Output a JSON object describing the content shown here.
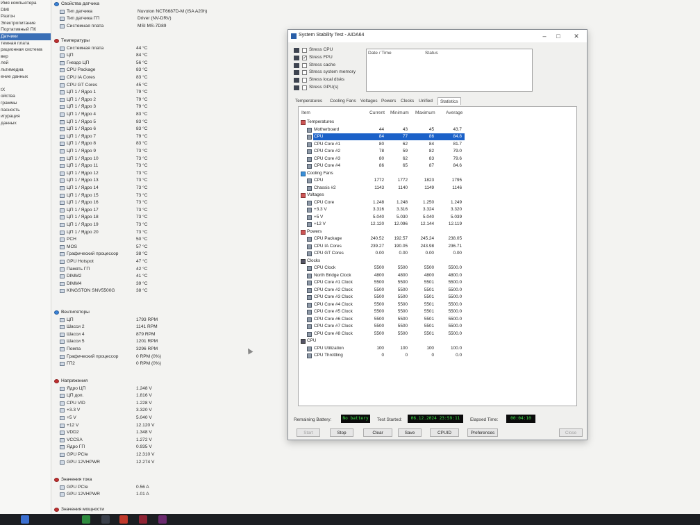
{
  "left_nav": {
    "items": [
      "Имя компьютера",
      "DMI",
      "Разгон",
      "Электропитание",
      "Портативный ПК",
      "Датчики",
      "темная плата",
      "рационная система",
      "вер",
      "лей",
      "льтимедиа",
      "ение данных",
      "",
      "tX",
      "ойства",
      "граммы",
      "пасность",
      "игурация",
      "данных",
      ""
    ],
    "selected_index": 5
  },
  "sensor_props": {
    "title": "Свойства датчика",
    "rows": [
      {
        "name": "Тип датчика",
        "value": "Nuvoton NCT6687D-M  (ISA A20h)"
      },
      {
        "name": "Тип датчика ГП",
        "value": "Driver  (NV-DRV)"
      },
      {
        "name": "Системная плата",
        "value": "MSI MS-7D89"
      }
    ]
  },
  "temperatures": {
    "title": "Температуры",
    "rows": [
      {
        "name": "Системная плата",
        "value": "44 °C"
      },
      {
        "name": "ЦП",
        "value": "84 °C"
      },
      {
        "name": "Гнездо ЦП",
        "value": "56 °C"
      },
      {
        "name": "CPU Package",
        "value": "83 °C"
      },
      {
        "name": "CPU IA Cores",
        "value": "83 °C"
      },
      {
        "name": "CPU GT Cores",
        "value": "45 °C"
      },
      {
        "name": "ЦП 1 / Ядро 1",
        "value": "79 °C"
      },
      {
        "name": "ЦП 1 / Ядро 2",
        "value": "79 °C"
      },
      {
        "name": "ЦП 1 / Ядро 3",
        "value": "79 °C"
      },
      {
        "name": "ЦП 1 / Ядро 4",
        "value": "83 °C"
      },
      {
        "name": "ЦП 1 / Ядро 5",
        "value": "83 °C"
      },
      {
        "name": "ЦП 1 / Ядро 6",
        "value": "83 °C"
      },
      {
        "name": "ЦП 1 / Ядро 7",
        "value": "79 °C"
      },
      {
        "name": "ЦП 1 / Ядро 8",
        "value": "83 °C"
      },
      {
        "name": "ЦП 1 / Ядро 9",
        "value": "73 °C"
      },
      {
        "name": "ЦП 1 / Ядро 10",
        "value": "73 °C"
      },
      {
        "name": "ЦП 1 / Ядро 11",
        "value": "73 °C"
      },
      {
        "name": "ЦП 1 / Ядро 12",
        "value": "73 °C"
      },
      {
        "name": "ЦП 1 / Ядро 13",
        "value": "73 °C"
      },
      {
        "name": "ЦП 1 / Ядро 14",
        "value": "73 °C"
      },
      {
        "name": "ЦП 1 / Ядро 15",
        "value": "73 °C"
      },
      {
        "name": "ЦП 1 / Ядро 16",
        "value": "73 °C"
      },
      {
        "name": "ЦП 1 / Ядро 17",
        "value": "73 °C"
      },
      {
        "name": "ЦП 1 / Ядро 18",
        "value": "73 °C"
      },
      {
        "name": "ЦП 1 / Ядро 19",
        "value": "73 °C"
      },
      {
        "name": "ЦП 1 / Ядро 20",
        "value": "73 °C"
      },
      {
        "name": "PCH",
        "value": "50 °C"
      },
      {
        "name": "MOS",
        "value": "57 °C"
      },
      {
        "name": "Графический процессор",
        "value": "38 °C"
      },
      {
        "name": "GPU Hotspot",
        "value": "47 °C"
      },
      {
        "name": "Память ГП",
        "value": "42 °C"
      },
      {
        "name": "DIMM2",
        "value": "41 °C"
      },
      {
        "name": "DIMM4",
        "value": "39 °C"
      },
      {
        "name": "KINGSTON SNV5500G",
        "value": "38 °C"
      }
    ]
  },
  "fans": {
    "title": "Вентиляторы",
    "rows": [
      {
        "name": "ЦП",
        "value": "1793 RPM"
      },
      {
        "name": "Шасси 2",
        "value": "1141 RPM"
      },
      {
        "name": "Шасси 4",
        "value": "879 RPM"
      },
      {
        "name": "Шасси 5",
        "value": "1201 RPM"
      },
      {
        "name": "Помпа",
        "value": "3296 RPM"
      },
      {
        "name": "Графический процессор",
        "value": "0 RPM  (0%)"
      },
      {
        "name": "ГП2",
        "value": "0 RPM  (0%)"
      }
    ]
  },
  "voltages": {
    "title": "Напряжения",
    "rows": [
      {
        "name": "Ядро ЦП",
        "value": "1.248 V"
      },
      {
        "name": "ЦП доп.",
        "value": "1.816 V"
      },
      {
        "name": "CPU VID",
        "value": "1.228 V"
      },
      {
        "name": "+3.3 V",
        "value": "3.320 V"
      },
      {
        "name": "+5 V",
        "value": "5.040 V"
      },
      {
        "name": "+12 V",
        "value": "12.120 V"
      },
      {
        "name": "VDD2",
        "value": "1.348 V"
      },
      {
        "name": "VCCSA",
        "value": "1.272 V"
      },
      {
        "name": "Ядро ГП",
        "value": "0.935 V"
      },
      {
        "name": "GPU PCIe",
        "value": "12.310 V"
      },
      {
        "name": "GPU 12VHPWR",
        "value": "12.274 V"
      }
    ]
  },
  "currents": {
    "title": "Значения тока",
    "rows": [
      {
        "name": "GPU PCIe",
        "value": "0.56 A"
      },
      {
        "name": "GPU 12VHPWR",
        "value": "1.01 A"
      }
    ]
  },
  "powers_partial": {
    "title": "Значения мощности"
  },
  "dialog": {
    "title": "System Stability Test - AIDA64",
    "window_buttons": {
      "minimize": "–",
      "maximize": "□",
      "close": "✕"
    },
    "stress_options": [
      {
        "label": "Stress CPU",
        "checked": false
      },
      {
        "label": "Stress FPU",
        "checked": true
      },
      {
        "label": "Stress cache",
        "checked": false
      },
      {
        "label": "Stress system memory",
        "checked": false
      },
      {
        "label": "Stress local disks",
        "checked": false
      },
      {
        "label": "Stress GPU(s)",
        "checked": false
      }
    ],
    "log_headers": {
      "date": "Date / Time",
      "status": "Status"
    },
    "tabs": [
      "Temperatures",
      "Cooling Fans",
      "Voltages",
      "Powers",
      "Clocks",
      "Unified",
      "Statistics"
    ],
    "active_tab": "Statistics",
    "columns": {
      "item": "Item",
      "current": "Current",
      "minimum": "Minimum",
      "maximum": "Maximum",
      "average": "Average"
    },
    "rows": [
      {
        "type": "group",
        "icon": "temp",
        "name": "Temperatures"
      },
      {
        "type": "row",
        "name": "Motherboard",
        "cur": "44",
        "min": "43",
        "max": "45",
        "avg": "43.7"
      },
      {
        "type": "row",
        "name": "CPU",
        "cur": "84",
        "min": "77",
        "max": "86",
        "avg": "84.8",
        "selected": true
      },
      {
        "type": "row",
        "name": "CPU Core #1",
        "cur": "80",
        "min": "62",
        "max": "84",
        "avg": "81.7"
      },
      {
        "type": "row",
        "name": "CPU Core #2",
        "cur": "78",
        "min": "59",
        "max": "82",
        "avg": "79.0"
      },
      {
        "type": "row",
        "name": "CPU Core #3",
        "cur": "80",
        "min": "62",
        "max": "83",
        "avg": "79.6"
      },
      {
        "type": "row",
        "name": "CPU Core #4",
        "cur": "86",
        "min": "65",
        "max": "87",
        "avg": "84.6"
      },
      {
        "type": "group",
        "icon": "fan",
        "name": "Cooling Fans"
      },
      {
        "type": "row",
        "name": "CPU",
        "cur": "1772",
        "min": "1772",
        "max": "1823",
        "avg": "1795"
      },
      {
        "type": "row",
        "name": "Chassis #2",
        "cur": "1143",
        "min": "1140",
        "max": "1149",
        "avg": "1146"
      },
      {
        "type": "group",
        "icon": "temp",
        "name": "Voltages"
      },
      {
        "type": "row",
        "name": "CPU Core",
        "cur": "1.248",
        "min": "1.248",
        "max": "1.250",
        "avg": "1.249"
      },
      {
        "type": "row",
        "name": "+3.3 V",
        "cur": "3.316",
        "min": "3.316",
        "max": "3.324",
        "avg": "3.320"
      },
      {
        "type": "row",
        "name": "+5 V",
        "cur": "5.040",
        "min": "5.030",
        "max": "5.040",
        "avg": "5.039"
      },
      {
        "type": "row",
        "name": "+12 V",
        "cur": "12.120",
        "min": "12.096",
        "max": "12.144",
        "avg": "12.119"
      },
      {
        "type": "group",
        "icon": "temp",
        "name": "Powers"
      },
      {
        "type": "row",
        "name": "CPU Package",
        "cur": "240.52",
        "min": "192.57",
        "max": "245.24",
        "avg": "238.05"
      },
      {
        "type": "row",
        "name": "CPU IA Cores",
        "cur": "239.27",
        "min": "190.05",
        "max": "243.98",
        "avg": "236.71"
      },
      {
        "type": "row",
        "name": "CPU GT Cores",
        "cur": "0.00",
        "min": "0.00",
        "max": "0.00",
        "avg": "0.00"
      },
      {
        "type": "group",
        "icon": "cpu",
        "name": "Clocks"
      },
      {
        "type": "row",
        "name": "CPU Clock",
        "cur": "5500",
        "min": "5500",
        "max": "5500",
        "avg": "5500.0"
      },
      {
        "type": "row",
        "name": "North Bridge Clock",
        "cur": "4800",
        "min": "4800",
        "max": "4800",
        "avg": "4800.0"
      },
      {
        "type": "row",
        "name": "CPU Core #1 Clock",
        "cur": "5500",
        "min": "5500",
        "max": "5501",
        "avg": "5500.0"
      },
      {
        "type": "row",
        "name": "CPU Core #2 Clock",
        "cur": "5500",
        "min": "5500",
        "max": "5501",
        "avg": "5500.0"
      },
      {
        "type": "row",
        "name": "CPU Core #3 Clock",
        "cur": "5500",
        "min": "5500",
        "max": "5501",
        "avg": "5500.0"
      },
      {
        "type": "row",
        "name": "CPU Core #4 Clock",
        "cur": "5500",
        "min": "5500",
        "max": "5501",
        "avg": "5500.0"
      },
      {
        "type": "row",
        "name": "CPU Core #5 Clock",
        "cur": "5500",
        "min": "5500",
        "max": "5501",
        "avg": "5500.0"
      },
      {
        "type": "row",
        "name": "CPU Core #6 Clock",
        "cur": "5500",
        "min": "5500",
        "max": "5501",
        "avg": "5500.0"
      },
      {
        "type": "row",
        "name": "CPU Core #7 Clock",
        "cur": "5500",
        "min": "5500",
        "max": "5501",
        "avg": "5500.0"
      },
      {
        "type": "row",
        "name": "CPU Core #8 Clock",
        "cur": "5500",
        "min": "5500",
        "max": "5501",
        "avg": "5500.0"
      },
      {
        "type": "group",
        "icon": "cpu",
        "name": "CPU"
      },
      {
        "type": "row",
        "name": "CPU Utilization",
        "cur": "100",
        "min": "100",
        "max": "100",
        "avg": "100.0"
      },
      {
        "type": "row",
        "name": "CPU Throttling",
        "cur": "0",
        "min": "0",
        "max": "0",
        "avg": "0.0"
      }
    ],
    "footer": {
      "remaining_battery_label": "Remaining Battery:",
      "remaining_battery_value": "No battery",
      "test_started_label": "Test Started:",
      "test_started_value": "06.12.2024 23:59:11",
      "elapsed_label": "Elapsed Time:",
      "elapsed_value": "00:04:10"
    },
    "buttons": [
      "Start",
      "Stop",
      "Clear",
      "Save",
      "CPUID",
      "Preferences",
      "Close"
    ],
    "disabled_buttons": [
      "Start",
      "Close"
    ]
  }
}
